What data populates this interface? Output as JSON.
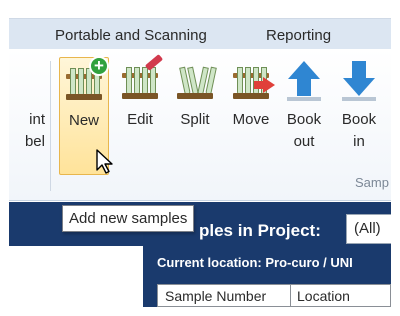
{
  "menubar": {
    "items": [
      "Portable and Scanning",
      "Reporting"
    ]
  },
  "ribbon": {
    "partial_left_label": [
      "int",
      "bel"
    ],
    "buttons": [
      {
        "label": "New",
        "icon": "test-tube-rack-add-icon"
      },
      {
        "label": "Edit",
        "icon": "test-tube-rack-edit-icon"
      },
      {
        "label": "Split",
        "icon": "test-tube-rack-split-icon"
      },
      {
        "label": "Move",
        "icon": "test-tube-rack-move-icon"
      },
      {
        "label_line1": "Book",
        "label_line2": "out",
        "icon": "book-out-arrow-icon"
      },
      {
        "label_line1": "Book",
        "label_line2": "in",
        "icon": "book-in-arrow-icon"
      }
    ],
    "group_caption": "Samp"
  },
  "tooltip": {
    "text": "Add new samples"
  },
  "main": {
    "heading": "ples in Project:",
    "project_filter_value": "(All)",
    "current_location": "Current location: Pro-curo / UNI",
    "table_columns": [
      "Sample Number",
      "Location"
    ]
  },
  "colors": {
    "menubar": "#dce6f2",
    "navy_panel": "#1a3a6d",
    "hover_fill": "#ffe39a",
    "arrow_blue": "#2f86d2"
  }
}
